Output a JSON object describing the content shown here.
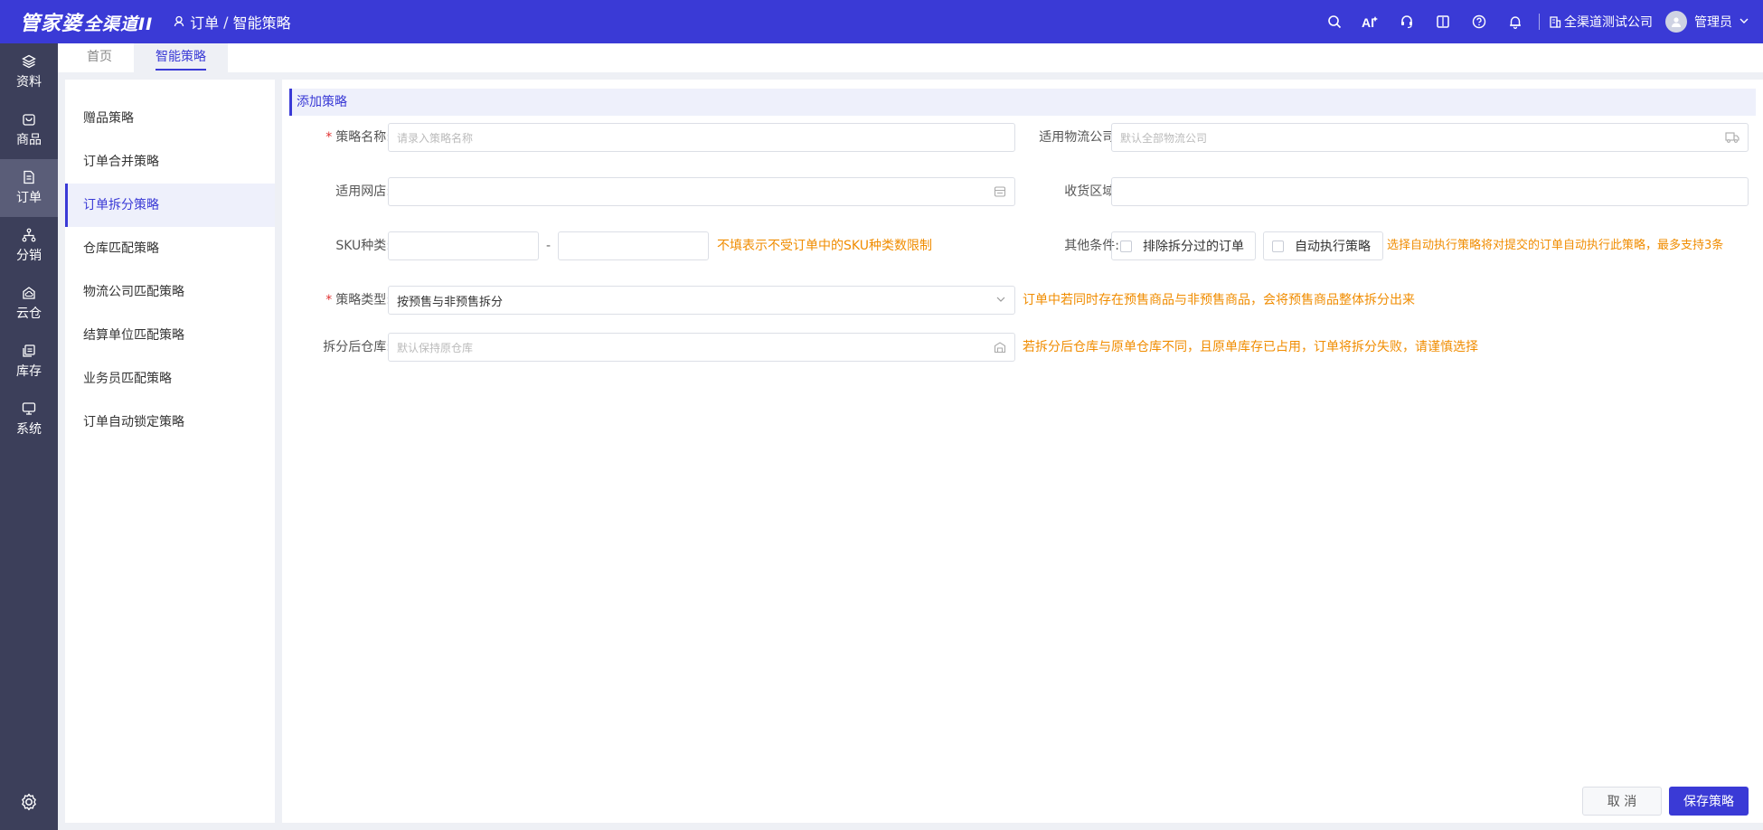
{
  "header": {
    "logo_main": "管家婆",
    "logo_sub": "全渠道II",
    "breadcrumb": [
      "订单",
      "智能策略"
    ],
    "company": "全渠道测试公司",
    "user": "管理员"
  },
  "rail": {
    "items": [
      {
        "label": "资料",
        "icon": "layers-icon"
      },
      {
        "label": "商品",
        "icon": "product-icon"
      },
      {
        "label": "订单",
        "icon": "order-icon",
        "active": true
      },
      {
        "label": "分销",
        "icon": "distribution-icon"
      },
      {
        "label": "云仓",
        "icon": "cloud-warehouse-icon"
      },
      {
        "label": "库存",
        "icon": "inventory-icon"
      },
      {
        "label": "系统",
        "icon": "monitor-icon"
      }
    ]
  },
  "tabs": [
    {
      "label": "首页"
    },
    {
      "label": "智能策略",
      "active": true
    }
  ],
  "menu": {
    "items": [
      "赠品策略",
      "订单合并策略",
      "订单拆分策略",
      "仓库匹配策略",
      "物流公司匹配策略",
      "结算单位匹配策略",
      "业务员匹配策略",
      "订单自动锁定策略"
    ],
    "active_index": 2
  },
  "form": {
    "section_title": "添加策略",
    "name_label": "策略名称:",
    "name_placeholder": "请录入策略名称",
    "logistics_label": "适用物流公司:",
    "logistics_placeholder": "默认全部物流公司",
    "shop_label": "适用网店:",
    "region_label": "收货区域:",
    "sku_label": "SKU种类:",
    "sku_dash": "-",
    "sku_hint": "不填表示不受订单中的SKU种类数限制",
    "other_label": "其他条件:",
    "other_opt1": "排除拆分过的订单",
    "other_opt2": "自动执行策略",
    "other_hint": "选择自动执行策略将对提交的订单自动执行此策略，最多支持3条",
    "type_label": "策略类型:",
    "type_value": "按预售与非预售拆分",
    "type_hint": "订单中若同时存在预售商品与非预售商品，会将预售商品整体拆分出来",
    "warehouse_label": "拆分后仓库:",
    "warehouse_placeholder": "默认保持原仓库",
    "warehouse_hint": "若拆分后仓库与原单仓库不同，且原单库存已占用，订单将拆分失败，请谨慎选择"
  },
  "actions": {
    "cancel": "取 消",
    "save": "保存策略"
  },
  "colors": {
    "brand": "#3a3ad6",
    "rail": "#3c3f5a",
    "hint": "#f08c00",
    "required": "#e03131"
  }
}
